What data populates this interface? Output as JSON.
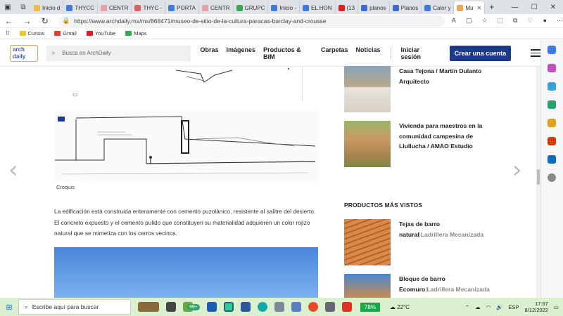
{
  "browser": {
    "tabs": [
      {
        "label": "Inicio d",
        "color": "#f2b94a"
      },
      {
        "label": "THYCC",
        "color": "#3d7be0"
      },
      {
        "label": "CENTR",
        "color": "#e8a0a0"
      },
      {
        "label": "THYC -",
        "color": "#e06060"
      },
      {
        "label": "PORTA",
        "color": "#3d7be0"
      },
      {
        "label": "CENTR",
        "color": "#e8a0a0"
      },
      {
        "label": "GRUPC",
        "color": "#37a852"
      },
      {
        "label": "Inicio -",
        "color": "#3d7be0"
      },
      {
        "label": "EL HON",
        "color": "#3d7be0"
      },
      {
        "label": "(13",
        "color": "#e02020"
      },
      {
        "label": "planos",
        "color": "#3b6bd8"
      },
      {
        "label": "Planos",
        "color": "#3b6bd8"
      },
      {
        "label": "Calor y",
        "color": "#3d7be0"
      },
      {
        "label": "Mu",
        "color": "#f0a64b"
      }
    ],
    "url": "https://www.archdaily.mx/mx/868471/museo-de-sitio-de-la-cultura-paracas-barclay-and-crousse",
    "bookmarks": [
      {
        "label": "Cursos",
        "color": "#f0c040"
      },
      {
        "label": "Gmail",
        "color": "#e04030"
      },
      {
        "label": "YouTube",
        "color": "#e02020"
      },
      {
        "label": "Maps",
        "color": "#37a852"
      }
    ]
  },
  "site": {
    "logo": "arch daily",
    "search_placeholder": "Busca en ArchDaily",
    "nav": [
      "Obras",
      "Imágenes",
      "Productos & BIM",
      "Carpetas",
      "Noticias"
    ],
    "login": "Iniciar sesión",
    "cta": "Crear una cuenta"
  },
  "article": {
    "caption": "Croquis",
    "body": "La edificación está construida enteramente con cemento puzolánico, resistente al salitre del desierto. El concreto expuesto y el cemento pulido que constituyen su materialidad adquieren un color rojizo natural que se mimetiza con los cerros vecinos."
  },
  "sidebar": {
    "related": [
      {
        "title": "Casa Tejona / Martín Dulanto Arquitecto"
      },
      {
        "title": "Vivienda para maestros en la comunidad campesina de Llullucha / AMAO Estudio"
      }
    ],
    "products_heading": "PRODUCTOS MÁS VISTOS",
    "products": [
      {
        "name": "Tejas de barro natural",
        "brand": "Ladrillera Mecanizada"
      },
      {
        "name": "Bloque de barro Ecomuro",
        "brand": "Ladrillera Mecanizada"
      }
    ]
  },
  "taskbar": {
    "search_placeholder": "Escribe aquí para buscar",
    "badge": "99+",
    "battery": "78%",
    "temperature": "22°C",
    "language": "ESP",
    "time": "17:57",
    "date": "8/12/2022"
  }
}
